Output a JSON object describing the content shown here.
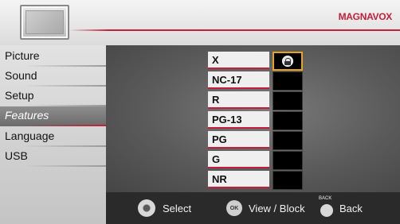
{
  "header": {
    "brand": "MAGNAVOX"
  },
  "sidebar": {
    "items": [
      {
        "label": "Picture",
        "active": false
      },
      {
        "label": "Sound",
        "active": false
      },
      {
        "label": "Setup",
        "active": false
      },
      {
        "label": "Features",
        "active": true
      },
      {
        "label": "Language",
        "active": false
      },
      {
        "label": "USB",
        "active": false
      }
    ]
  },
  "ratings": [
    {
      "label": "X",
      "locked": true,
      "focused": true
    },
    {
      "label": "NC-17",
      "locked": false,
      "focused": false
    },
    {
      "label": "R",
      "locked": false,
      "focused": false
    },
    {
      "label": "PG-13",
      "locked": false,
      "focused": false
    },
    {
      "label": "PG",
      "locked": false,
      "focused": false
    },
    {
      "label": "G",
      "locked": false,
      "focused": false
    },
    {
      "label": "NR",
      "locked": false,
      "focused": false
    }
  ],
  "footer": {
    "select_label": "Select",
    "ok_icon_text": "OK",
    "view_block_label": "View / Block",
    "back_icon_text": "BACK",
    "back_label": "Back"
  },
  "colors": {
    "accent": "#c41e3a",
    "focus": "#e8a31c"
  }
}
